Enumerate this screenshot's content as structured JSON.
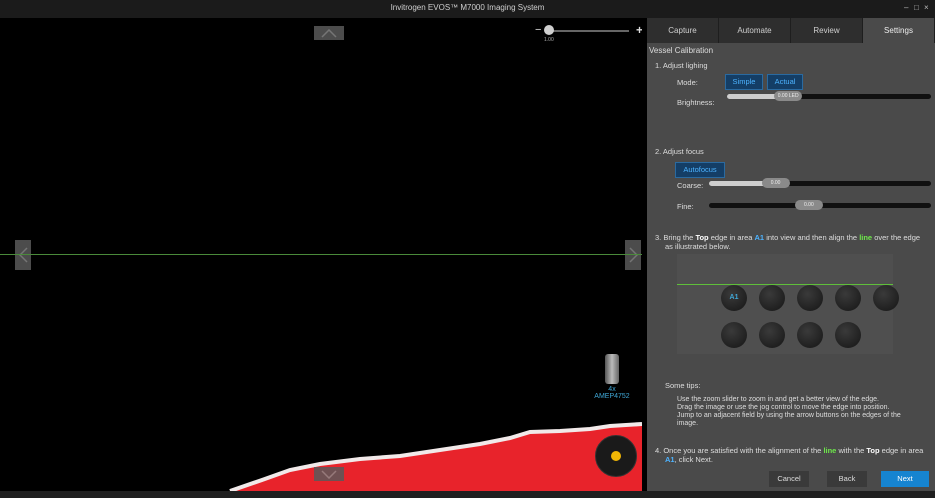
{
  "window": {
    "title": "Invitrogen EVOS™ M7000 Imaging System",
    "minimize": "–",
    "maximize": "□",
    "close": "×"
  },
  "viewer": {
    "zoom_value": "1.00",
    "zoom_minus": "−",
    "zoom_plus": "+",
    "objective_mag": "4x",
    "objective_code": "AMEP4752"
  },
  "tabs": [
    {
      "label": "Capture"
    },
    {
      "label": "Automate"
    },
    {
      "label": "Review"
    },
    {
      "label": "Settings"
    }
  ],
  "panel": {
    "title": "Vessel Calibration",
    "step1": "1. Adjust lighing",
    "mode_label": "Mode:",
    "mode_simple": "Simple",
    "mode_actual": "Actual",
    "brightness_label": "Brightness:",
    "brightness_value": "0.00 LED",
    "step2": "2. Adjust focus",
    "autofocus": "Autofocus",
    "coarse_label": "Coarse:",
    "coarse_value": "0.00",
    "fine_label": "Fine:",
    "fine_value": "0.00",
    "step3_a": "3. Bring the ",
    "step3_top": "Top",
    "step3_b": " edge in area ",
    "step3_a1": "A1",
    "step3_c": " into view and then align the ",
    "step3_line": "line",
    "step3_d": " over the edge",
    "step3_e": "as illustrated below.",
    "well_label": "A1",
    "tips_title": "Some tips:",
    "tip1": "Use the zoom slider to zoom in and get a better view of the edge.",
    "tip2": "Drag the image or use the jog control to move the edge into position.",
    "tip3": "Jump to an adjacent field by using the arrow buttons on the edges of the",
    "tip3b": "image.",
    "step4_a": "4. Once you are satisfied with the alignment of the ",
    "step4_line": "line",
    "step4_b": " with the ",
    "step4_top": "Top",
    "step4_c": " edge in area",
    "step4_a1": "A1",
    "step4_d": ", click Next.",
    "cancel": "Cancel",
    "back": "Back",
    "next": "Next"
  },
  "colors": {
    "accent": "#1684d0",
    "line": "#4a8a3a",
    "sample": "#e8232b",
    "jog_dot": "#f2b705"
  },
  "indicators": {
    "zoom_fraction": 0.0,
    "brightness_fraction": 0.3,
    "coarse_fraction": 0.3,
    "fine_fraction": 0.45
  }
}
